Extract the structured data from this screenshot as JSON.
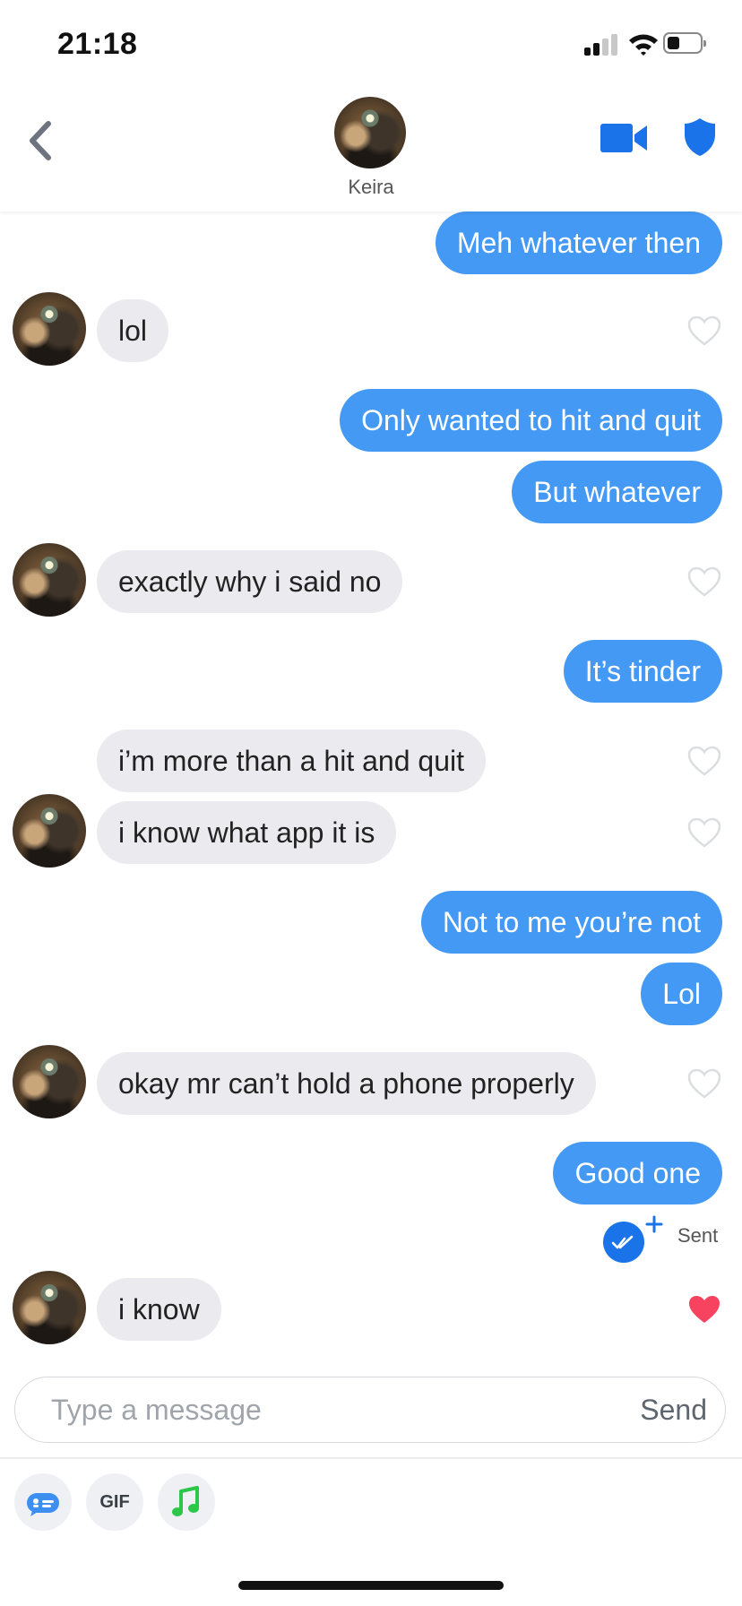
{
  "status_bar": {
    "time": "21:18"
  },
  "header": {
    "contact_name": "Keira",
    "icons": [
      "back-chevron-icon",
      "video-camera-icon",
      "shield-icon"
    ]
  },
  "messages": [
    {
      "from": "me",
      "text": "Meh whatever then"
    },
    {
      "from": "them",
      "text": "lol",
      "liked": false
    },
    {
      "from": "me",
      "text": "Only wanted to hit and quit"
    },
    {
      "from": "me",
      "text": "But whatever"
    },
    {
      "from": "them",
      "text": "exactly why i said no",
      "liked": false
    },
    {
      "from": "me",
      "text": "It’s tinder"
    },
    {
      "from": "them",
      "text": "i’m more than a hit and quit",
      "liked": false
    },
    {
      "from": "them",
      "text": "i know what app it is",
      "liked": false
    },
    {
      "from": "me",
      "text": "Not to me you’re not"
    },
    {
      "from": "me",
      "text": "Lol"
    },
    {
      "from": "them",
      "text": "okay mr can’t hold a phone properly",
      "liked": false
    },
    {
      "from": "me",
      "text": "Good one"
    },
    {
      "from": "them",
      "text": "i know",
      "liked": true
    }
  ],
  "receipt": {
    "status": "Sent"
  },
  "composer": {
    "placeholder": "Type a message",
    "send_label": "Send"
  },
  "tools": {
    "gif_label": "GIF",
    "icons": [
      "bitmoji-icon",
      "gif-icon",
      "music-note-icon"
    ]
  },
  "colors": {
    "sent_bubble": "#4499f4",
    "recv_bubble": "#ebebef",
    "heart_active": "#f7435f",
    "brand_blue": "#1a73e8",
    "music_green": "#2cc64a"
  }
}
